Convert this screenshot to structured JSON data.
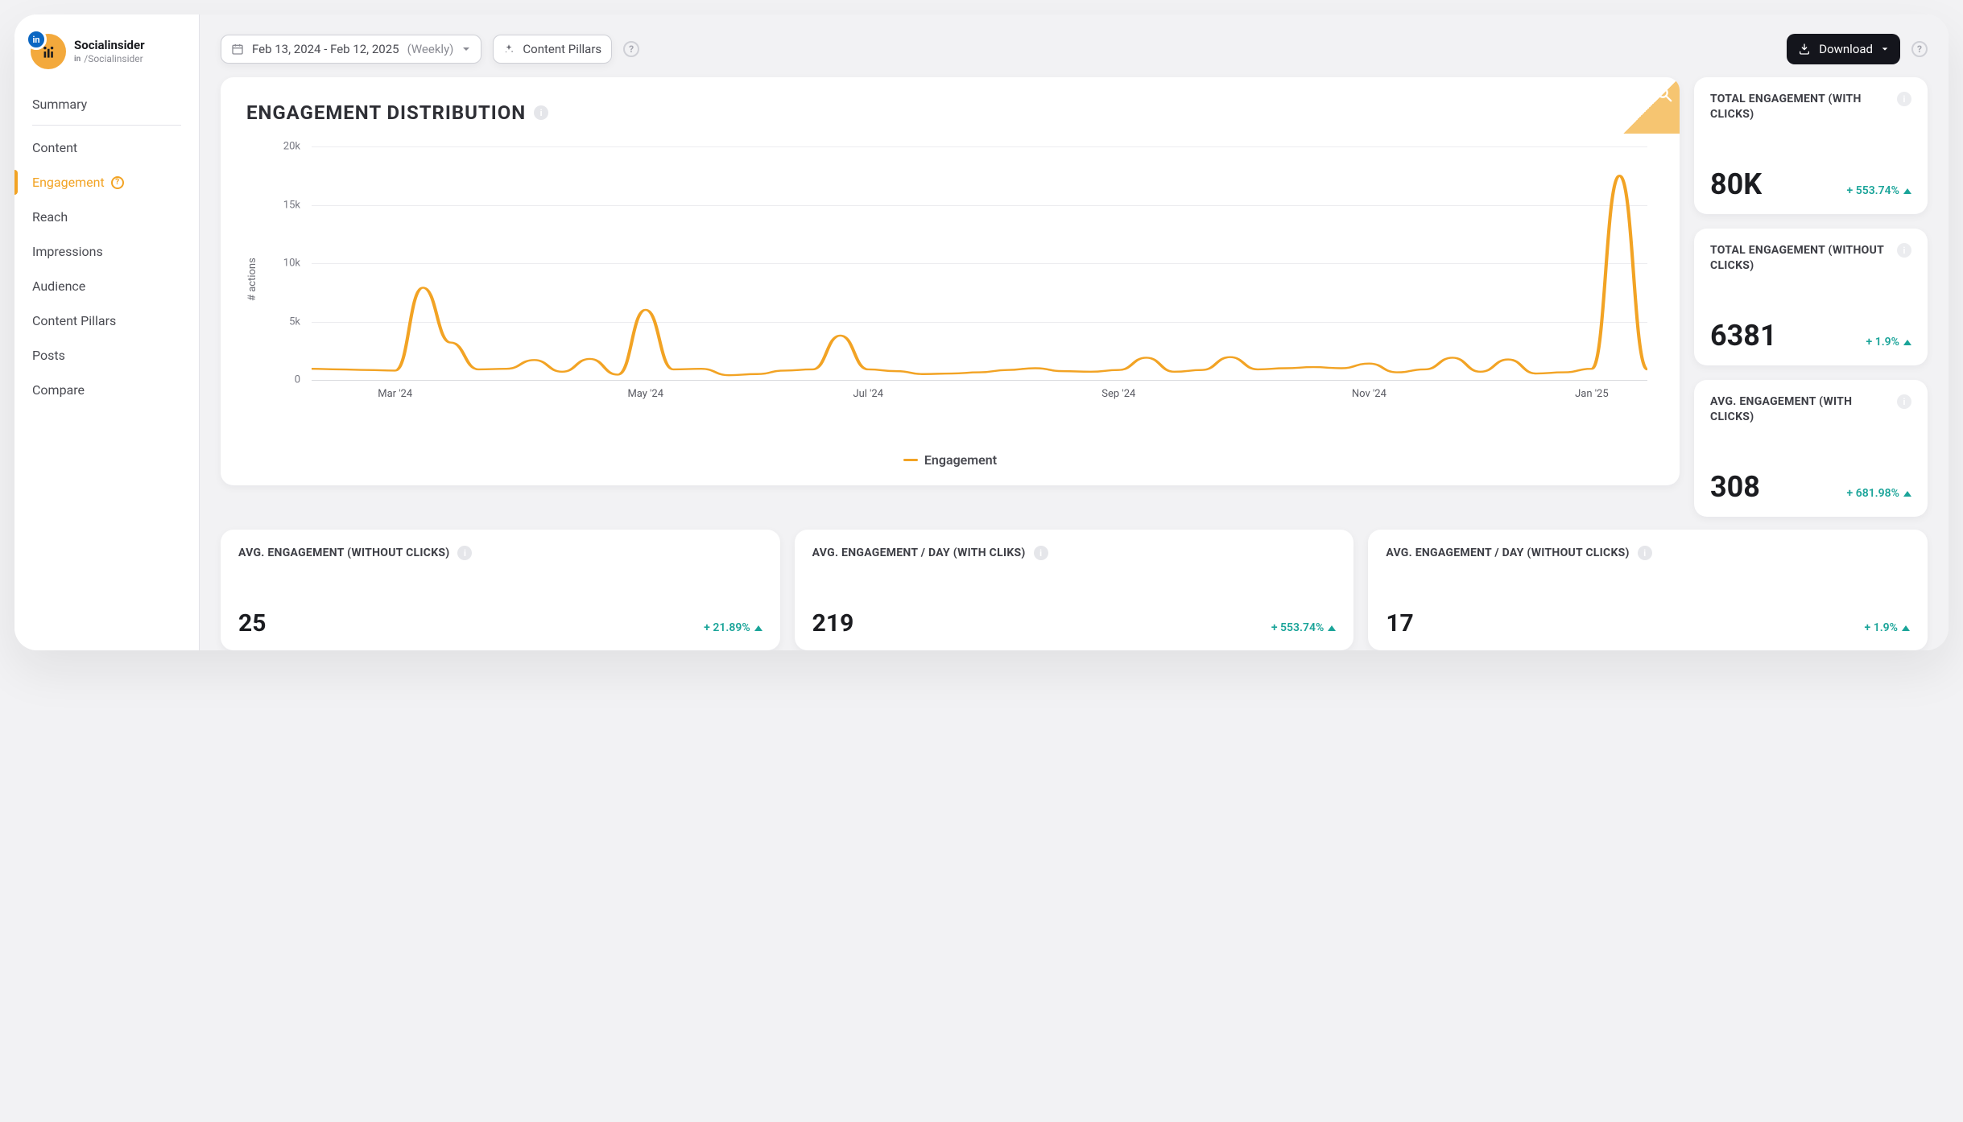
{
  "brand": {
    "name": "Socialinsider",
    "handle_prefix": "in",
    "handle": "/Socialinsider"
  },
  "nav": {
    "summary": "Summary",
    "content": "Content",
    "engagement": "Engagement",
    "reach": "Reach",
    "impressions": "Impressions",
    "audience": "Audience",
    "pillars": "Content Pillars",
    "posts": "Posts",
    "compare": "Compare"
  },
  "topbar": {
    "date_label": "Feb 13, 2024 - Feb 12, 2025",
    "date_granularity": "(Weekly)",
    "pillars_btn": "Content Pillars",
    "download": "Download"
  },
  "chart_data": {
    "type": "line",
    "title": "ENGAGEMENT DISTRIBUTION",
    "ylabel": "# actions",
    "ylim": [
      0,
      20000
    ],
    "yticks": [
      "20k",
      "15k",
      "10k",
      "5k",
      "0"
    ],
    "x_categories": [
      "Mar '24",
      "May '24",
      "Jul '24",
      "Sep '24",
      "Nov '24",
      "Jan '25"
    ],
    "series": [
      {
        "name": "Engagement",
        "color": "#f2a324",
        "values": [
          950,
          900,
          850,
          800,
          7900,
          3200,
          900,
          950,
          1700,
          700,
          1800,
          450,
          6000,
          900,
          950,
          400,
          500,
          800,
          900,
          3800,
          900,
          750,
          500,
          550,
          650,
          850,
          1000,
          750,
          700,
          850,
          1900,
          700,
          850,
          1950,
          900,
          1000,
          1100,
          1000,
          1400,
          650,
          900,
          1900,
          700,
          1750,
          550,
          650,
          950,
          17500,
          900
        ]
      }
    ],
    "legend": "Engagement"
  },
  "kpis_right": [
    {
      "title": "TOTAL ENGAGEMENT (WITH CLICKS)",
      "value": "80K",
      "delta": "+ 553.74%"
    },
    {
      "title": "TOTAL ENGAGEMENT (WITHOUT CLICKS)",
      "value": "6381",
      "delta": "+ 1.9%"
    },
    {
      "title": "AVG. ENGAGEMENT (WITH CLICKS)",
      "value": "308",
      "delta": "+ 681.98%"
    }
  ],
  "kpis_bottom": [
    {
      "title": "AVG. ENGAGEMENT (WITHOUT CLICKS)",
      "value": "25",
      "delta": "+ 21.89%"
    },
    {
      "title": "AVG. ENGAGEMENT / DAY (WITH CLIKS)",
      "value": "219",
      "delta": "+ 553.74%"
    },
    {
      "title": "AVG. ENGAGEMENT / DAY (WITHOUT CLICKS)",
      "value": "17",
      "delta": "+ 1.9%"
    }
  ]
}
